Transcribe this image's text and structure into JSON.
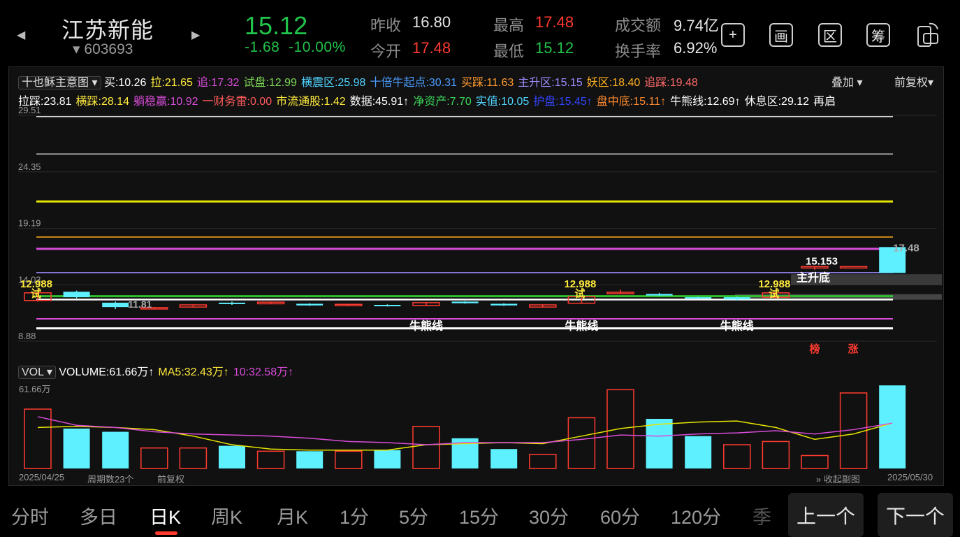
{
  "stock": {
    "name": "江苏新能",
    "code": "603693",
    "price": "15.12",
    "change": "-1.68",
    "change_pct": "-10.00%"
  },
  "stats": {
    "prev_close_label": "昨收",
    "prev_close": "16.80",
    "open_label": "今开",
    "open": "17.48",
    "high_label": "最高",
    "high": "17.48",
    "low_label": "最低",
    "low": "15.12",
    "turnover_label": "成交额",
    "turnover": "9.74亿",
    "rate_label": "换手率",
    "rate": "6.92%"
  },
  "header_buttons": [
    "+",
    "画",
    "区",
    "筹"
  ],
  "chart": {
    "indicator_select": "十也稣主意图",
    "overlay_label": "叠加",
    "adjust_label": "前复权",
    "row1": [
      {
        "t": "买:10.26",
        "c": "#ffffff"
      },
      {
        "t": "拉:21.65",
        "c": "#ffea3c"
      },
      {
        "t": "追:17.32",
        "c": "#d94cd9"
      },
      {
        "t": "试盘:12.99",
        "c": "#7ed957"
      },
      {
        "t": "横震区:25.98",
        "c": "#4fd4ff"
      },
      {
        "t": "十倍牛起点:30.31",
        "c": "#4a9cff"
      },
      {
        "t": "买踩:11.63",
        "c": "#ff9a2e"
      },
      {
        "t": "主升区:15.15",
        "c": "#9b8cff"
      },
      {
        "t": "妖区:18.40",
        "c": "#ffb020"
      },
      {
        "t": "追踩:19.48",
        "c": "#ff6a6a"
      }
    ],
    "row2": [
      {
        "t": "拉踩:23.81",
        "c": "#ffffff"
      },
      {
        "t": "横踩:28.14",
        "c": "#ffea3c"
      },
      {
        "t": "躺稳赢:10.92",
        "c": "#d94cd9"
      },
      {
        "t": "一财务雷:0.00",
        "c": "#ff5a5a"
      },
      {
        "t": "市流通股:1.42",
        "c": "#ffea3c"
      },
      {
        "t": "数据:45.91↑",
        "c": "#ffffff"
      },
      {
        "t": "净资产:7.70",
        "c": "#3ad65a"
      },
      {
        "t": "实值:10.05",
        "c": "#4fd4ff"
      },
      {
        "t": "护盘:15.45↑",
        "c": "#3344ff"
      },
      {
        "t": "盘中底:15.11↑",
        "c": "#ff8a2e"
      },
      {
        "t": "牛熊线:12.69↑",
        "c": "#ffffff"
      },
      {
        "t": "休息区:29.12",
        "c": "#ffffff"
      },
      {
        "t": "再启",
        "c": "#ffffff"
      }
    ],
    "y_ticks": [
      "29.51",
      "24.35",
      "19.19",
      "14.03",
      "8.88"
    ],
    "annotations": {
      "t12988": "12.988",
      "shi": "试",
      "low_label": "11.81",
      "niu": "牛熊线",
      "ref_line": "15.153",
      "zhusheng": "主升底",
      "last_close": "17.48",
      "bang": "榜",
      "zhang": "涨"
    },
    "vol_select": "VOL",
    "vol_row": [
      {
        "t": "VOLUME:61.66万↑",
        "c": "#ffffff"
      },
      {
        "t": "MA5:32.43万↑",
        "c": "#ffea3c"
      },
      {
        "t": "10:32.58万↑",
        "c": "#d94cd9"
      }
    ],
    "vol_max_label": "61.66万",
    "footer": {
      "start": "2025/04/25",
      "periods": "周期数23个",
      "adjust": "前复权",
      "collapse": "收起副图",
      "end": "2025/05/30"
    }
  },
  "chart_data": {
    "type": "candlestick",
    "ylim": [
      8.88,
      29.51
    ],
    "candles": [
      {
        "o": 13.3,
        "c": 12.6,
        "h": 13.4,
        "l": 12.5,
        "up": true
      },
      {
        "o": 13.4,
        "c": 12.9,
        "h": 13.5,
        "l": 12.8,
        "up": false
      },
      {
        "o": 12.4,
        "c": 12.0,
        "h": 12.5,
        "l": 11.81,
        "up": false
      },
      {
        "o": 11.85,
        "c": 11.95,
        "h": 12.0,
        "l": 11.8,
        "up": true
      },
      {
        "o": 12.0,
        "c": 12.2,
        "h": 12.25,
        "l": 11.95,
        "up": true
      },
      {
        "o": 12.4,
        "c": 12.3,
        "h": 12.5,
        "l": 12.2,
        "up": false
      },
      {
        "o": 12.45,
        "c": 12.3,
        "h": 12.5,
        "l": 12.25,
        "up": true
      },
      {
        "o": 12.3,
        "c": 12.15,
        "h": 12.35,
        "l": 12.1,
        "up": false
      },
      {
        "o": 12.25,
        "c": 12.15,
        "h": 12.3,
        "l": 12.1,
        "up": true
      },
      {
        "o": 12.2,
        "c": 12.15,
        "h": 12.25,
        "l": 12.05,
        "up": false
      },
      {
        "o": 12.15,
        "c": 12.4,
        "h": 12.45,
        "l": 12.1,
        "up": true
      },
      {
        "o": 12.35,
        "c": 12.5,
        "h": 12.55,
        "l": 12.3,
        "up": false
      },
      {
        "o": 12.3,
        "c": 12.15,
        "h": 12.35,
        "l": 12.1,
        "up": false
      },
      {
        "o": 12.2,
        "c": 12.0,
        "h": 12.25,
        "l": 11.95,
        "up": true
      },
      {
        "o": 12.35,
        "c": 12.95,
        "h": 13.0,
        "l": 12.3,
        "up": true
      },
      {
        "o": 13.25,
        "c": 13.35,
        "h": 13.6,
        "l": 13.2,
        "up": true
      },
      {
        "o": 13.2,
        "c": 13.05,
        "h": 13.3,
        "l": 13.0,
        "up": false
      },
      {
        "o": 12.9,
        "c": 12.85,
        "h": 12.95,
        "l": 12.8,
        "up": false
      },
      {
        "o": 12.9,
        "c": 12.7,
        "h": 12.95,
        "l": 12.6,
        "up": false
      },
      {
        "o": 12.9,
        "c": 13.3,
        "h": 13.35,
        "l": 12.8,
        "up": true
      },
      {
        "o": 15.7,
        "c": 15.7,
        "h": 15.7,
        "l": 15.4,
        "up": true
      },
      {
        "o": 15.7,
        "c": 15.7,
        "h": 15.7,
        "l": 15.7,
        "up": true
      },
      {
        "o": 17.48,
        "c": 15.12,
        "h": 17.48,
        "l": 15.12,
        "up": false
      }
    ],
    "lines": [
      {
        "name": "横震区",
        "value": 25.98,
        "color": "#c8c8c8",
        "thick": 1.5
      },
      {
        "name": "拉",
        "value": 21.65,
        "color": "#e6e600",
        "thick": 3
      },
      {
        "name": "妖区",
        "value": 18.4,
        "color": "#ffb020",
        "thick": 1.5
      },
      {
        "name": "追",
        "value": 17.32,
        "color": "#d94cd9",
        "thick": 3
      },
      {
        "name": "主升区",
        "value": 15.15,
        "color": "#9b8cff",
        "thick": 1.5
      },
      {
        "name": "试盘",
        "value": 12.99,
        "color": "#2fbf2f",
        "thick": 3
      },
      {
        "name": "买",
        "value": 12.69,
        "color": "#ffffff",
        "thick": 2.5
      },
      {
        "name": "躺稳赢",
        "value": 10.92,
        "color": "#d94cd9",
        "thick": 2
      },
      {
        "name": "实值",
        "value": 10.05,
        "color": "#ffffff",
        "thick": 3
      }
    ],
    "volume": {
      "max": 61.66,
      "values": [
        55,
        37,
        34,
        19,
        19,
        21,
        16,
        16,
        16,
        17,
        39,
        28,
        18,
        13,
        47,
        73,
        46,
        30,
        22,
        25,
        12,
        70,
        77
      ],
      "up": [
        true,
        false,
        false,
        true,
        true,
        false,
        true,
        false,
        true,
        false,
        true,
        false,
        false,
        true,
        true,
        true,
        false,
        false,
        true,
        true,
        true,
        true,
        false
      ],
      "ma5": [
        38,
        39,
        38,
        36,
        30,
        22,
        18,
        17,
        17,
        17,
        22,
        23,
        24,
        23,
        30,
        37,
        41,
        43,
        44,
        38,
        27,
        32,
        42
      ],
      "ma10": [
        48,
        40,
        38,
        34,
        32,
        31,
        30,
        28,
        25,
        24,
        22,
        24,
        24,
        24,
        27,
        31,
        30,
        32,
        33,
        35,
        32,
        36,
        42
      ]
    }
  }
}
